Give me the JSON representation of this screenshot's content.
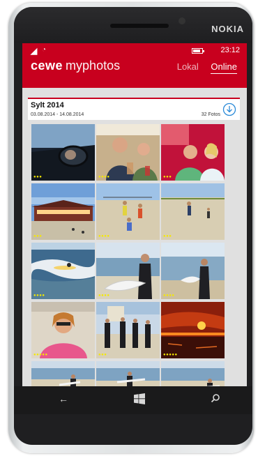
{
  "device": {
    "brand": "NOKIA"
  },
  "status_bar": {
    "time": "23:12",
    "battery_level": 0.85
  },
  "app": {
    "brand_bold": "cewe",
    "brand_light": "myphotos"
  },
  "tabs": [
    {
      "label": "Lokal",
      "active": false
    },
    {
      "label": "Online",
      "active": true
    }
  ],
  "album": {
    "title": "Sylt 2014",
    "dates": "03.08.2014 - 14.08.2014",
    "count": "32 Fotos"
  },
  "photos": [
    {
      "id": "car-mirror",
      "rating": 3
    },
    {
      "id": "men-at-bar",
      "rating": 4
    },
    {
      "id": "couple-smiling",
      "rating": 3
    },
    {
      "id": "beach-restaurant",
      "rating": 3
    },
    {
      "id": "beach-volleyball",
      "rating": 4
    },
    {
      "id": "beach-players",
      "rating": 3
    },
    {
      "id": "surfer-wave",
      "rating": 4
    },
    {
      "id": "wetsuit-surfboard",
      "rating": 4
    },
    {
      "id": "surfer-walking",
      "rating": 4
    },
    {
      "id": "woman-pink-hoodie",
      "rating": 5
    },
    {
      "id": "surfers-group",
      "rating": 3
    },
    {
      "id": "sunset",
      "rating": 5
    },
    {
      "id": "beach-walk-1",
      "rating": 0
    },
    {
      "id": "beach-walk-2",
      "rating": 0
    },
    {
      "id": "beach-walk-3",
      "rating": 0
    }
  ],
  "appbar": {
    "buttons": [
      "list-icon",
      "filter-icon"
    ],
    "more": "..."
  },
  "colors": {
    "accent": "#c8001e",
    "rating": "#f5e900"
  }
}
